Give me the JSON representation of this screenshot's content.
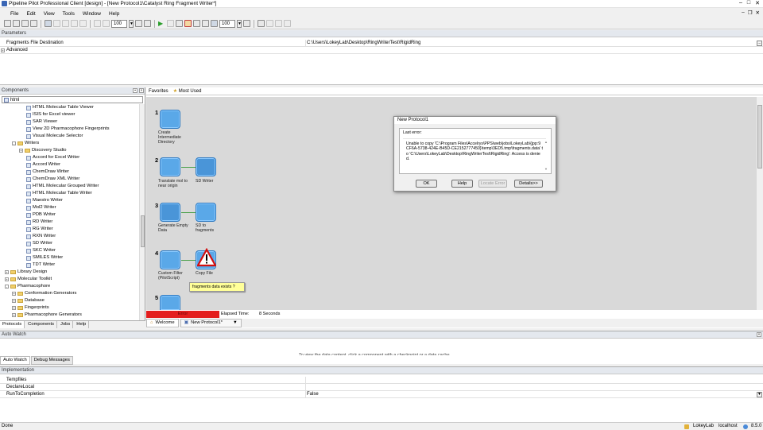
{
  "window": {
    "title": "Pipeline Pilot Professional Client [design] - [New Protocol1\\Catalyst Ring Fragment Writer*]"
  },
  "menu": [
    "File",
    "Edit",
    "View",
    "Tools",
    "Window",
    "Help"
  ],
  "toolbar": {
    "zoom1": "100",
    "zoom2": "100"
  },
  "parameters": {
    "header": "Parameters",
    "rows": [
      {
        "name": "Fragments File Destination",
        "value": "C:\\Users\\LokeyLab\\Desktop\\RingWriterTest\\RigidRing"
      },
      {
        "name": "Advanced",
        "value": ""
      }
    ]
  },
  "components": {
    "header": "Components",
    "search": "html",
    "tree": [
      {
        "label": "HTML Molecular Table Viewer",
        "level": 4,
        "kind": "doc"
      },
      {
        "label": "ISIS for Excel viewer",
        "level": 4,
        "kind": "doc"
      },
      {
        "label": "SAR Viewer",
        "level": 4,
        "kind": "doc"
      },
      {
        "label": "View 2D Pharmacophore Fingerprints",
        "level": 4,
        "kind": "doc"
      },
      {
        "label": "Visual Molecule Selector",
        "level": 4,
        "kind": "doc"
      },
      {
        "label": "Writers",
        "level": 2,
        "kind": "folder-open"
      },
      {
        "label": "Discovery Studio",
        "level": 3,
        "kind": "folder"
      },
      {
        "label": "Accord for Excel Writer",
        "level": 4,
        "kind": "doc"
      },
      {
        "label": "Accord Writer",
        "level": 4,
        "kind": "doc"
      },
      {
        "label": "ChemDraw Writer",
        "level": 4,
        "kind": "doc"
      },
      {
        "label": "ChemDraw XML Writer",
        "level": 4,
        "kind": "doc"
      },
      {
        "label": "HTML Molecular Grouped Writer",
        "level": 4,
        "kind": "doc"
      },
      {
        "label": "HTML Molecular Table Writer",
        "level": 4,
        "kind": "doc"
      },
      {
        "label": "Maestro Writer",
        "level": 4,
        "kind": "doc"
      },
      {
        "label": "Mol2 Writer",
        "level": 4,
        "kind": "doc"
      },
      {
        "label": "PDB Writer",
        "level": 4,
        "kind": "doc"
      },
      {
        "label": "RD Writer",
        "level": 4,
        "kind": "doc"
      },
      {
        "label": "RG Writer",
        "level": 4,
        "kind": "doc"
      },
      {
        "label": "RXN Writer",
        "level": 4,
        "kind": "doc"
      },
      {
        "label": "SD Writer",
        "level": 4,
        "kind": "doc"
      },
      {
        "label": "SKC Writer",
        "level": 4,
        "kind": "doc"
      },
      {
        "label": "SMILES Writer",
        "level": 4,
        "kind": "doc"
      },
      {
        "label": "TDT Writer",
        "level": 4,
        "kind": "doc"
      },
      {
        "label": "Library Design",
        "level": 1,
        "kind": "folder"
      },
      {
        "label": "Molecular Toolkit",
        "level": 1,
        "kind": "folder"
      },
      {
        "label": "Pharmacophore",
        "level": 1,
        "kind": "folder-open"
      },
      {
        "label": "Conformation Generators",
        "level": 2,
        "kind": "folder"
      },
      {
        "label": "Database",
        "level": 2,
        "kind": "folder"
      },
      {
        "label": "Fingerprints",
        "level": 2,
        "kind": "folder"
      },
      {
        "label": "Pharmacophore Generators",
        "level": 2,
        "kind": "folder"
      }
    ],
    "tabs": [
      "Protocols",
      "Components",
      "Jobs",
      "Help"
    ]
  },
  "favorites": {
    "label": "Favorites",
    "most_used": "Most Used"
  },
  "nodes": [
    {
      "num": "1",
      "label": "Create Intermediate Directory"
    },
    {
      "num": "2",
      "label": "Translate mol to near origin"
    },
    {
      "num": "",
      "label": "SD Writer"
    },
    {
      "num": "3",
      "label": "Generate Empty Data"
    },
    {
      "num": "",
      "label": "SD to fragments"
    },
    {
      "num": "4",
      "label": "Custom Filter (PilotScript)"
    },
    {
      "num": "",
      "label": "Copy File"
    },
    {
      "num": "5",
      "label": ""
    }
  ],
  "tooltip": "fragments data exists ?",
  "dialog": {
    "title": "New Protocol1",
    "last_error_label": "Last error:",
    "message": "Unable to copy 'C:\\Program Files\\Accelrys\\PPS\\web\\jobs\\LokeyLab\\{jpp:9CF6A-5738-424E-B45D-CE2152777450}\\temp\\3ED5.tmp\\fragments.data' to 'C:\\Users\\LokeyLab\\Desktop\\RingWriterTest\\RigidRing': Access is denied.",
    "buttons": [
      "OK",
      "Help",
      "Locate Error",
      "Details>>"
    ]
  },
  "status": {
    "error": "Error",
    "elapsed_label": "Elapsed Time:",
    "elapsed_value": "8 Seconds"
  },
  "doctabs": [
    "Welcome",
    "New Protocol1*"
  ],
  "autowatch": {
    "header": "Auto Watch",
    "hint": "To view the data content, click a component with a checkpoint or a data cache",
    "tabs": [
      "Auto Watch",
      "Debug Messages"
    ]
  },
  "implementation": {
    "header": "Implementation",
    "rows": [
      {
        "name": "Tempfiles",
        "value": ""
      },
      {
        "name": "DeclareLocal",
        "value": ""
      },
      {
        "name": "RunToCompletion",
        "value": "False"
      }
    ]
  },
  "statusbar": {
    "left": "Done",
    "user": "LokeyLab",
    "host": "localhost",
    "version": "8.5.0"
  }
}
